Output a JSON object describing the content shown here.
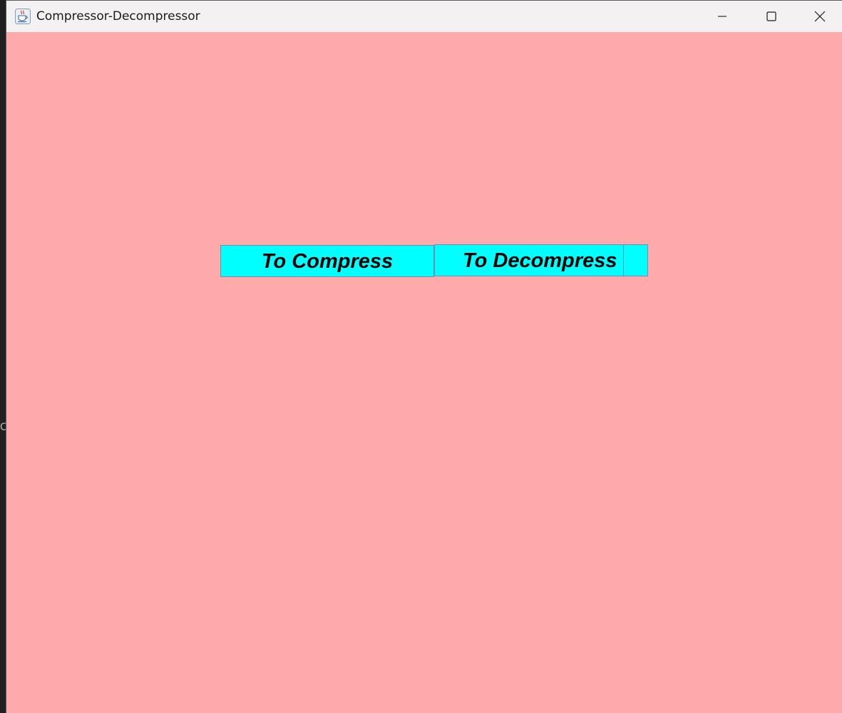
{
  "window": {
    "title": "Compressor-Decompressor",
    "app_icon": "java-cup-icon",
    "controls": {
      "minimize_icon": "minimize-icon",
      "maximize_icon": "maximize-icon",
      "close_icon": "close-icon"
    }
  },
  "main": {
    "compress_label": "To Compress",
    "decompress_label": "To Decompress"
  },
  "background_glyph": "C",
  "colors": {
    "content_background": "#ffaaaa",
    "button_background": "#00ffff",
    "titlebar_background": "#f4f1f3"
  }
}
